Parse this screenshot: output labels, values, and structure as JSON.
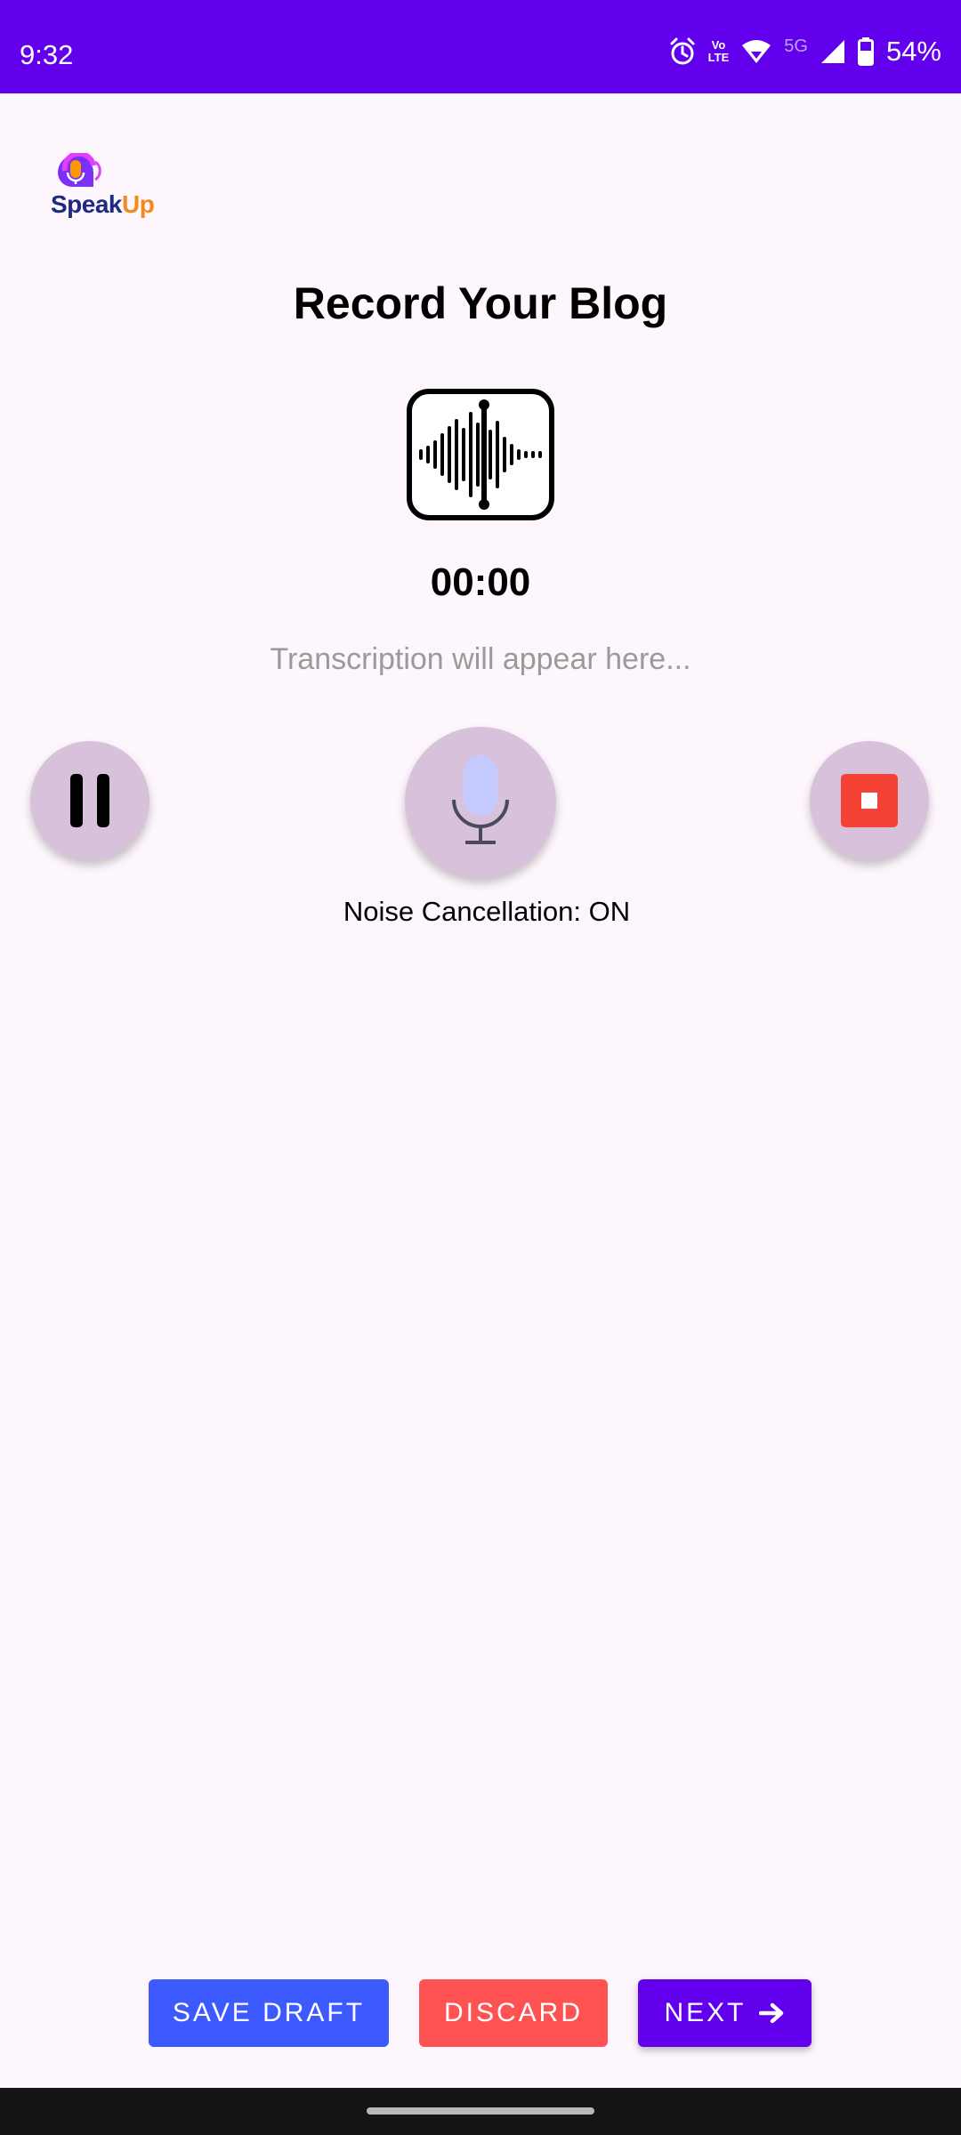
{
  "status_bar": {
    "time": "9:32",
    "lte_top": "Vo",
    "lte_bottom": "LTE",
    "network": "5G",
    "battery": "54%",
    "icons": [
      "alarm-icon",
      "volte-icon",
      "wifi-icon",
      "signal-icon",
      "battery-icon"
    ]
  },
  "app": {
    "logo_speak": "Speak",
    "logo_up": "Up"
  },
  "main": {
    "title": "Record Your Blog",
    "timer": "00:00",
    "transcription_placeholder": "Transcription will appear here...",
    "noise_cancellation": "Noise Cancellation: ON"
  },
  "controls": {
    "icons": [
      "pause-icon",
      "microphone-icon",
      "stop-icon"
    ]
  },
  "actions": {
    "save_draft": "SAVE DRAFT",
    "discard": "DISCARD",
    "next": "NEXT"
  },
  "colors": {
    "status_bar": "#6200ee",
    "background": "#fdf6fc",
    "control_circle": "#d8c2db",
    "save_draft": "#3d5afe",
    "discard": "#ff5252",
    "next": "#6200ee",
    "stop": "#f44336"
  }
}
